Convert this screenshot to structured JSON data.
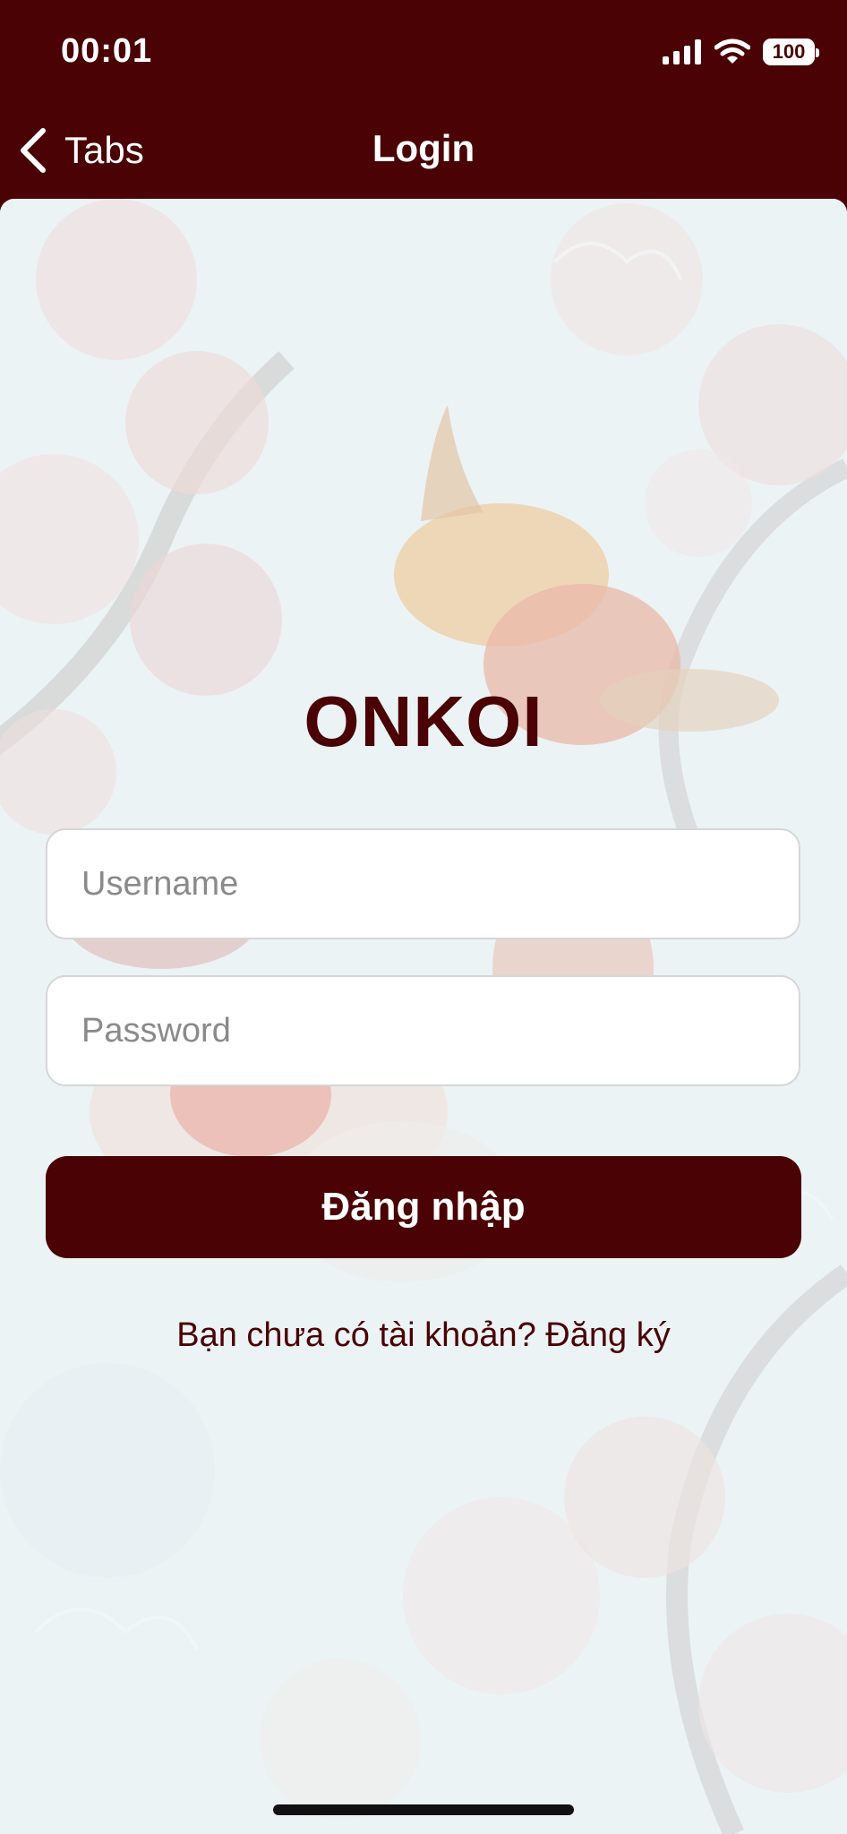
{
  "status_bar": {
    "time": "00:01",
    "battery": "100",
    "icons": [
      "cellular-signal-icon",
      "wifi-icon",
      "battery-icon"
    ]
  },
  "nav": {
    "back_label": "Tabs",
    "title": "Login",
    "back_icon": "chevron-left-icon"
  },
  "login": {
    "brand": "ONKOI",
    "username_placeholder": "Username",
    "username_value": "",
    "password_placeholder": "Password",
    "password_value": "",
    "submit_label": "Đăng nhập",
    "register_prompt": "Bạn chưa có tài khoản? Đăng ký"
  },
  "colors": {
    "primary": "#4a0205",
    "background": "#e6f0f2",
    "input_border": "#d6d6d6",
    "placeholder": "#8a8a8a",
    "white": "#ffffff"
  }
}
